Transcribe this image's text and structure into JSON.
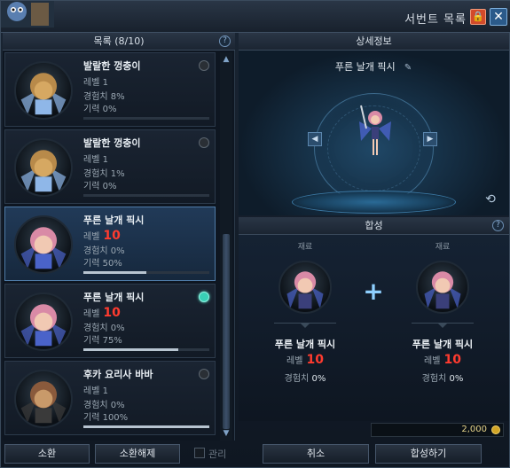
{
  "window": {
    "title": "서번트 목록",
    "lock_glyph": "🔒",
    "close_glyph": "✕"
  },
  "left": {
    "header": "목록 (8/10)",
    "help_glyph": "?",
    "items": [
      {
        "name": "발랄한 껑충이",
        "level_text": "레벨 1",
        "level_big": "",
        "exp": "경험치 8%",
        "energy": "기력 0%",
        "bar": 0,
        "radio": "off",
        "selected": false
      },
      {
        "name": "발랄한 껑충이",
        "level_text": "레벨 1",
        "level_big": "",
        "exp": "경험치 1%",
        "energy": "기력 0%",
        "bar": 0,
        "radio": "off",
        "selected": false
      },
      {
        "name": "푸른 날개 픽시",
        "level_text": "레벨",
        "level_big": "10",
        "exp": "경험치 0%",
        "energy": "기력 50%",
        "bar": 0.5,
        "radio": "none",
        "selected": true
      },
      {
        "name": "푸른 날개 픽시",
        "level_text": "레벨",
        "level_big": "10",
        "exp": "경험치 0%",
        "energy": "기력 75%",
        "bar": 0.75,
        "radio": "on",
        "selected": false
      },
      {
        "name": "후카 요리사 바바",
        "level_text": "레벨 1",
        "level_big": "",
        "exp": "경험치 0%",
        "energy": "기력 100%",
        "bar": 1.0,
        "radio": "off",
        "selected": false
      }
    ],
    "summon_btn": "소환",
    "unsummon_btn": "소환해제",
    "manage_label": "관리"
  },
  "detail": {
    "header": "상세정보",
    "pet_name": "푸른 날개 픽시",
    "edit_glyph": "✎",
    "prev_glyph": "◀",
    "next_glyph": "▶",
    "rotate_glyph": "⟲"
  },
  "synth": {
    "header": "합성",
    "help_glyph": "?",
    "material_label": "재료",
    "plus_glyph": "+",
    "left_mat": {
      "name": "푸른 날개 픽시",
      "level_text": "레벨",
      "level_big": "10",
      "exp_label": "경험치",
      "exp_val": "0%"
    },
    "right_mat": {
      "name": "푸른 날개 픽시",
      "level_text": "레벨",
      "level_big": "10",
      "exp_label": "경험치",
      "exp_val": "0%"
    },
    "cost": "2,000",
    "cancel_btn": "취소",
    "synth_btn": "합성하기"
  }
}
